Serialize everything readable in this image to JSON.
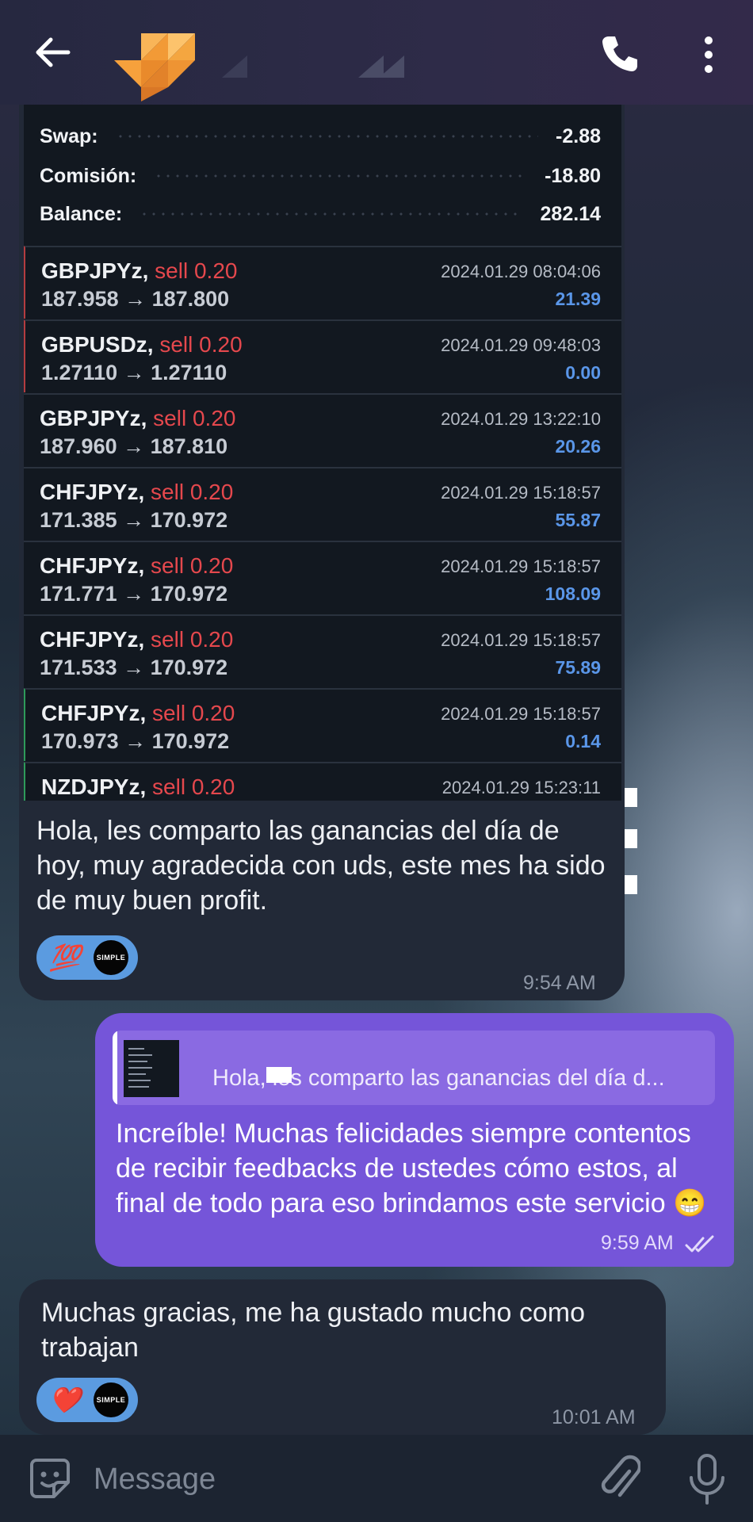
{
  "header": {
    "back_icon": "arrow-left-icon",
    "logo_icon": "orange-arrow-logo",
    "call_icon": "phone-icon",
    "more_icon": "more-vertical-icon"
  },
  "screenshot": {
    "summary": [
      {
        "label": "Swap:",
        "value": "-2.88"
      },
      {
        "label": "Comisión:",
        "value": "-18.80"
      },
      {
        "label": "Balance:",
        "value": "282.14"
      }
    ],
    "trades": [
      {
        "symbol": "GBPJPYz,",
        "side": "sell 0.20",
        "prices": "187.958 → 187.800",
        "date": "2024.01.29 08:04:06",
        "profit": "21.39"
      },
      {
        "symbol": "GBPUSDz,",
        "side": "sell 0.20",
        "prices": "1.27110 → 1.27110",
        "date": "2024.01.29 09:48:03",
        "profit": "0.00"
      },
      {
        "symbol": "GBPJPYz,",
        "side": "sell 0.20",
        "prices": "187.960 → 187.810",
        "date": "2024.01.29 13:22:10",
        "profit": "20.26"
      },
      {
        "symbol": "CHFJPYz,",
        "side": "sell 0.20",
        "prices": "171.385 → 170.972",
        "date": "2024.01.29 15:18:57",
        "profit": "55.87"
      },
      {
        "symbol": "CHFJPYz,",
        "side": "sell 0.20",
        "prices": "171.771 → 170.972",
        "date": "2024.01.29 15:18:57",
        "profit": "108.09"
      },
      {
        "symbol": "CHFJPYz,",
        "side": "sell 0.20",
        "prices": "171.533 → 170.972",
        "date": "2024.01.29 15:18:57",
        "profit": "75.89"
      },
      {
        "symbol": "CHFJPYz,",
        "side": "sell 0.20",
        "prices": "170.973 → 170.972",
        "date": "2024.01.29 15:18:57",
        "profit": "0.14"
      },
      {
        "symbol": "NZDJPYz,",
        "side": "sell 0.20",
        "prices": "",
        "date": "2024.01.29 15:23:11",
        "profit": ""
      }
    ]
  },
  "messages": {
    "incoming1": {
      "text": "Hola, les comparto las ganancias del día de hoy, muy agradecida con uds, este mes ha sido de muy buen profit.",
      "reaction_emoji": "💯",
      "avatar_text": "SIMPLE",
      "time": "9:54 AM"
    },
    "outgoing": {
      "reply_preview": "Hola, les comparto las ganancias del día d...",
      "text": "Increíble! Muchas felicidades siempre contentos de recibir feedbacks de ustedes cómo estos, al final de todo para eso brindamos este servicio 😁",
      "time": "9:59 AM",
      "status_icon": "double-check-icon"
    },
    "incoming2": {
      "text": "Muchas gracias, me ha gustado mucho como trabajan",
      "reaction_emoji": "❤️",
      "avatar_text": "SIMPLE",
      "time": "10:01 AM"
    }
  },
  "composer": {
    "placeholder": "Message",
    "sticker_icon": "sticker-icon",
    "attach_icon": "paperclip-icon",
    "mic_icon": "microphone-icon"
  }
}
